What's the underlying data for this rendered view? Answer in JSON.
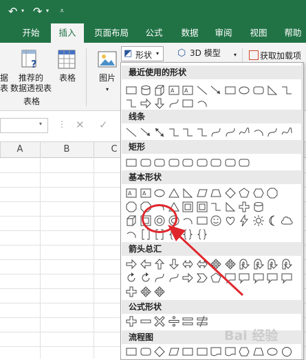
{
  "tabs": [
    "开始",
    "插入",
    "页面布局",
    "公式",
    "数据",
    "审阅",
    "视图",
    "帮助"
  ],
  "active_tab": "插入",
  "ribbon": {
    "left_label_lines": [
      "据",
      "表"
    ],
    "recommended_pivot_line1": "推荐的",
    "recommended_pivot_line2": "数据透视表",
    "table_label": "表格",
    "group_label": "表格",
    "pictures_label": "图片",
    "shapes_button_label": "形状",
    "model3d_label": "3D 模型",
    "addins_label": "获取加载项",
    "addins_cut": "加"
  },
  "columns": [
    "A",
    "B",
    "C"
  ],
  "shapes_panel": {
    "sections": [
      {
        "title": "最近使用的形状"
      },
      {
        "title": "线条"
      },
      {
        "title": "矩形"
      },
      {
        "title": "基本形状"
      },
      {
        "title": "箭头总汇"
      },
      {
        "title": "公式形状"
      },
      {
        "title": "流程图"
      }
    ]
  },
  "watermark": "Bai 经验",
  "colors": {
    "excel_green": "#217346",
    "highlight_red": "#e0262d"
  }
}
